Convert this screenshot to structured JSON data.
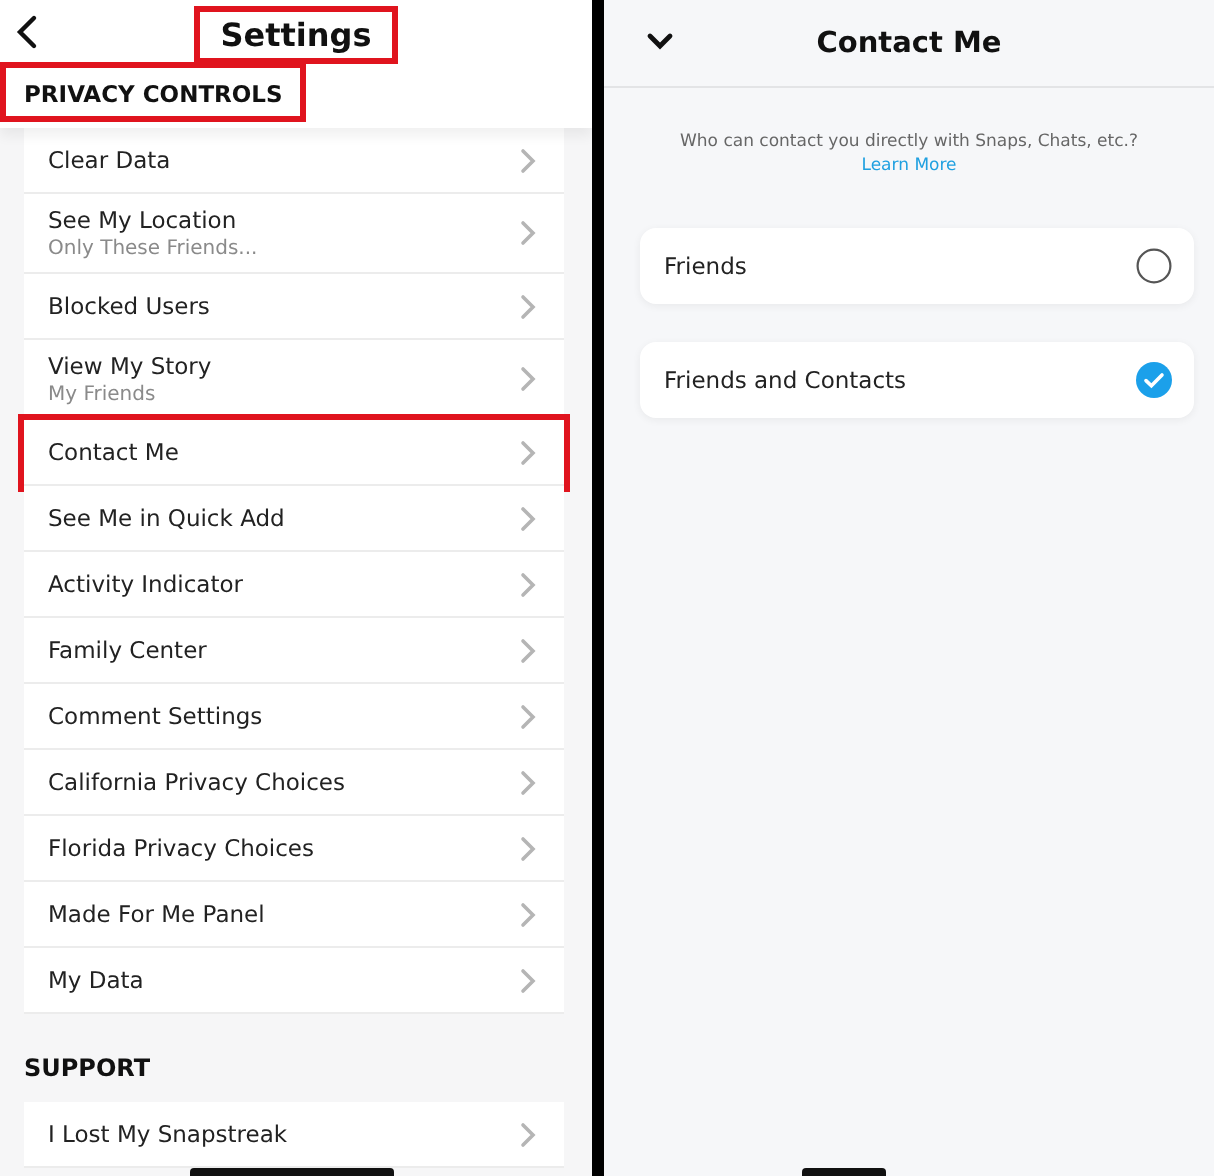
{
  "settings_screen": {
    "title": "Settings",
    "title_highlighted": true,
    "sections": [
      {
        "heading": "PRIVACY CONTROLS",
        "highlighted": true,
        "items": [
          {
            "label": "Clear Data",
            "highlighted": false
          },
          {
            "label": "See My Location",
            "detail": "Only These Friends...",
            "highlighted": false
          },
          {
            "label": "Blocked Users",
            "highlighted": false
          },
          {
            "label": "View My Story",
            "detail": "My Friends",
            "highlighted": false
          },
          {
            "label": "Contact Me",
            "highlighted": true
          },
          {
            "label": "See Me in Quick Add",
            "highlighted": false
          },
          {
            "label": "Activity Indicator",
            "highlighted": false
          },
          {
            "label": "Family Center",
            "highlighted": false
          },
          {
            "label": "Comment Settings",
            "highlighted": false
          },
          {
            "label": "California Privacy Choices",
            "highlighted": false
          },
          {
            "label": "Florida Privacy Choices",
            "highlighted": false
          },
          {
            "label": "Made For Me Panel",
            "highlighted": false
          },
          {
            "label": "My Data",
            "highlighted": false
          }
        ]
      },
      {
        "heading": "SUPPORT",
        "highlighted": false,
        "items": [
          {
            "label": "I Lost My Snapstreak",
            "highlighted": false
          }
        ]
      }
    ]
  },
  "contact_screen": {
    "title": "Contact Me",
    "question": "Who can contact you directly with Snaps, Chats, etc.?",
    "link": "Learn More",
    "options": [
      {
        "label": "Friends",
        "selected": false
      },
      {
        "label": "Friends and Contacts",
        "selected": true
      }
    ]
  }
}
